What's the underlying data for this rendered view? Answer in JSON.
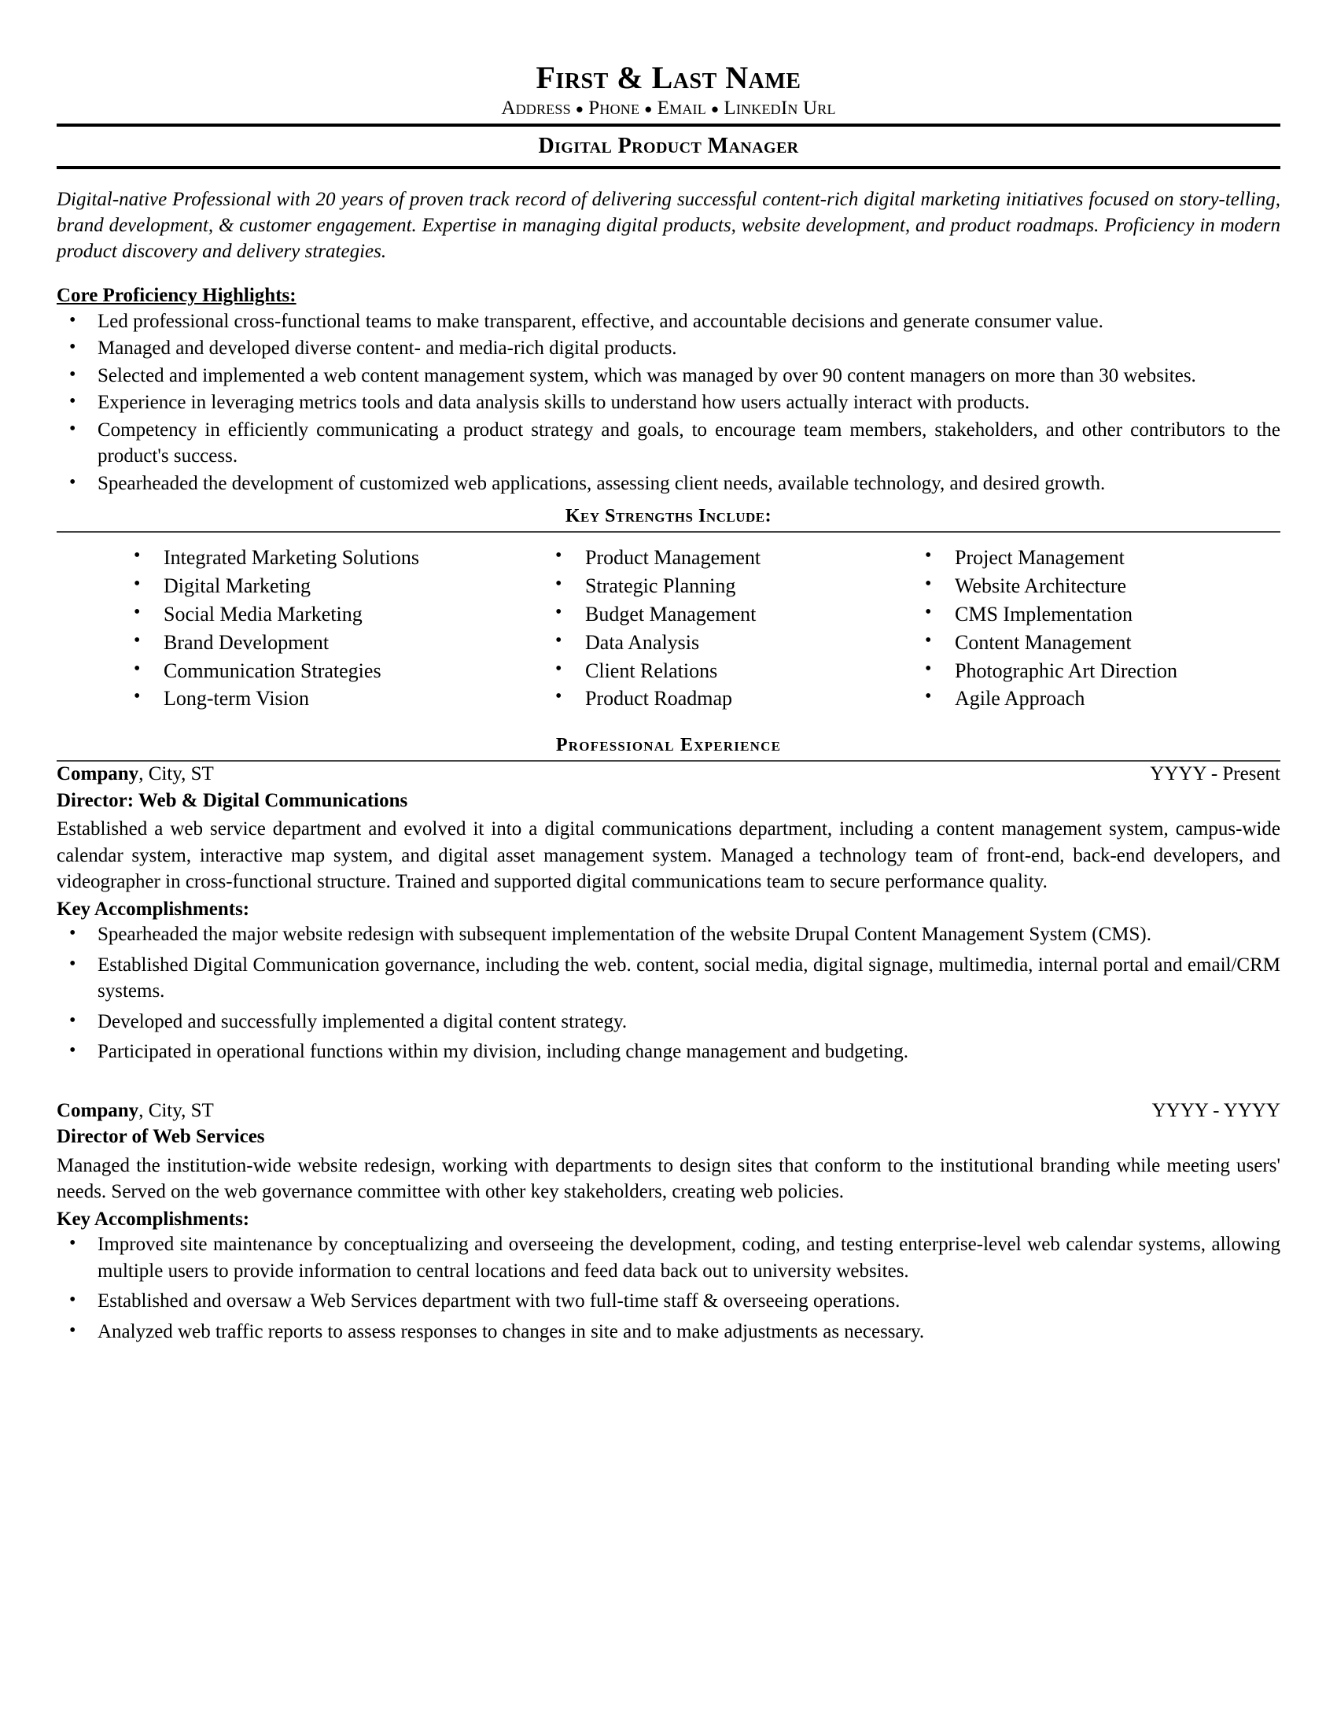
{
  "header": {
    "name": "First & Last Name",
    "contact_parts": [
      "Address",
      "Phone",
      "Email",
      "LinkedIn Url"
    ],
    "separator": "●",
    "target_title": "Digital Product Manager"
  },
  "summary": {
    "text": "Digital-native Professional with 20 years of proven track record of delivering successful content-rich digital marketing initiatives focused on story-telling, brand development, & customer engagement. Expertise in managing digital products, website development, and product roadmaps. Proficiency in modern product discovery and delivery strategies."
  },
  "core_proficiency": {
    "heading": "Core Proficiency Highlights:",
    "items": [
      "Led professional cross-functional teams to make transparent, effective, and accountable decisions and generate consumer value.",
      "Managed and developed diverse content- and media-rich digital products.",
      "Selected and implemented a web content management system, which was managed by over 90 content managers on more than 30 websites.",
      "Experience in leveraging metrics tools and data analysis skills to understand how users actually interact with products.",
      "Competency in efficiently communicating a product strategy and goals, to encourage team members, stakeholders, and other contributors to the product's success.",
      "Spearheaded the development of customized web applications, assessing client needs, available technology, and desired growth."
    ]
  },
  "key_strengths": {
    "heading": "Key Strengths Include:",
    "columns": [
      [
        "Integrated Marketing Solutions",
        "Digital Marketing",
        "Social Media Marketing",
        "Brand Development",
        "Communication Strategies",
        "Long-term Vision"
      ],
      [
        "Product Management",
        "Strategic Planning",
        "Budget Management",
        "Data Analysis",
        "Client Relations",
        "Product Roadmap"
      ],
      [
        "Project Management",
        "Website Architecture",
        "CMS Implementation",
        "Content Management",
        "Photographic Art Direction",
        "Agile Approach"
      ]
    ]
  },
  "experience": {
    "heading": "Professional  Experience",
    "accomplishments_label": "Key Accomplishments:",
    "entries": [
      {
        "company": "Company",
        "location": ", City, ST",
        "dates": "YYYY - Present",
        "role": "Director: Web & Digital Communications",
        "description": "Established a web service department and evolved it into a digital communications department, including a content management system, campus-wide calendar system, interactive map system, and digital asset management system. Managed a technology team of front-end, back-end developers, and videographer in cross-functional structure. Trained and supported digital communications team to secure performance quality.",
        "accomplishments": [
          "Spearheaded the major website redesign with subsequent implementation of the website Drupal Content Management System (CMS).",
          "Established Digital Communication governance, including the web. content, social media, digital signage, multimedia, internal portal and email/CRM systems.",
          "Developed and successfully implemented a digital content strategy.",
          "Participated in operational functions within my division, including change management and budgeting."
        ]
      },
      {
        "company": "Company",
        "location": ", City, ST",
        "dates": "YYYY - YYYY",
        "role": "Director of Web Services",
        "description": "Managed the institution-wide website redesign, working with departments to design sites that conform to the institutional branding while meeting users' needs. Served on the web governance committee with other key stakeholders, creating web policies.",
        "accomplishments": [
          "Improved site maintenance by conceptualizing and overseeing the development, coding, and testing enterprise-level web calendar systems, allowing multiple users to provide information to central locations and feed data back out to university websites.",
          "Established and oversaw a Web Services department with two full-time staff & overseeing operations.",
          "Analyzed web traffic reports to assess responses to changes in site and to make adjustments as necessary."
        ]
      }
    ]
  }
}
